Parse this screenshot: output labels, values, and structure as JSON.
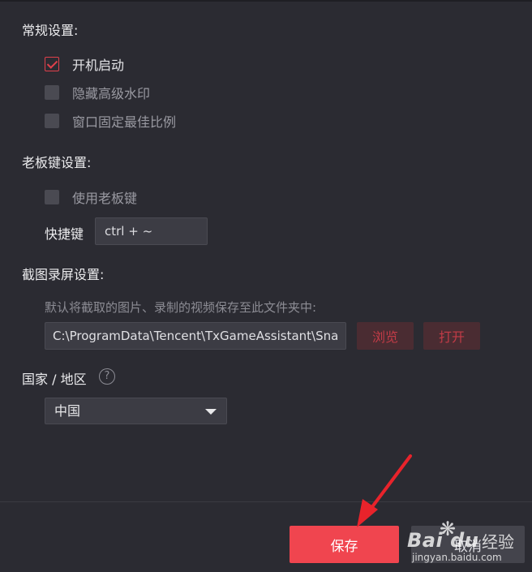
{
  "sections": {
    "general": "常规设置:",
    "boss_key": "老板键设置:",
    "capture": "截图录屏设置:",
    "region": "国家 / 地区"
  },
  "general": {
    "autostart": {
      "label": "开机启动",
      "checked": true
    },
    "hide_watermark": {
      "label": "隐藏高级水印",
      "checked": false
    },
    "fixed_ratio": {
      "label": "窗口固定最佳比例",
      "checked": false
    }
  },
  "boss_key": {
    "use": {
      "label": "使用老板键",
      "checked": false
    },
    "hotkey_label": "快捷键",
    "hotkey_value": "ctrl + ~"
  },
  "capture": {
    "hint": "默认将截取的图片、录制的视频保存至此文件夹中:",
    "path": "C:\\ProgramData\\Tencent\\TxGameAssistant\\Sna",
    "browse_label": "浏览",
    "open_label": "打开"
  },
  "region": {
    "help_icon": "?",
    "selected": "中国"
  },
  "footer": {
    "save_label": "保存",
    "cancel_label": "取消"
  },
  "watermark": {
    "brand": "Bai du",
    "cn": "经验",
    "url": "jingyan.baidu.com"
  },
  "colors": {
    "background": "#2b2b32",
    "accent": "#f0454f",
    "checkbox_checked": "#e0404b",
    "annotation_arrow": "#e8232b"
  },
  "icons": [
    "checkmark-icon",
    "help-icon",
    "chevron-down-icon",
    "arrow-annotation-icon"
  ]
}
